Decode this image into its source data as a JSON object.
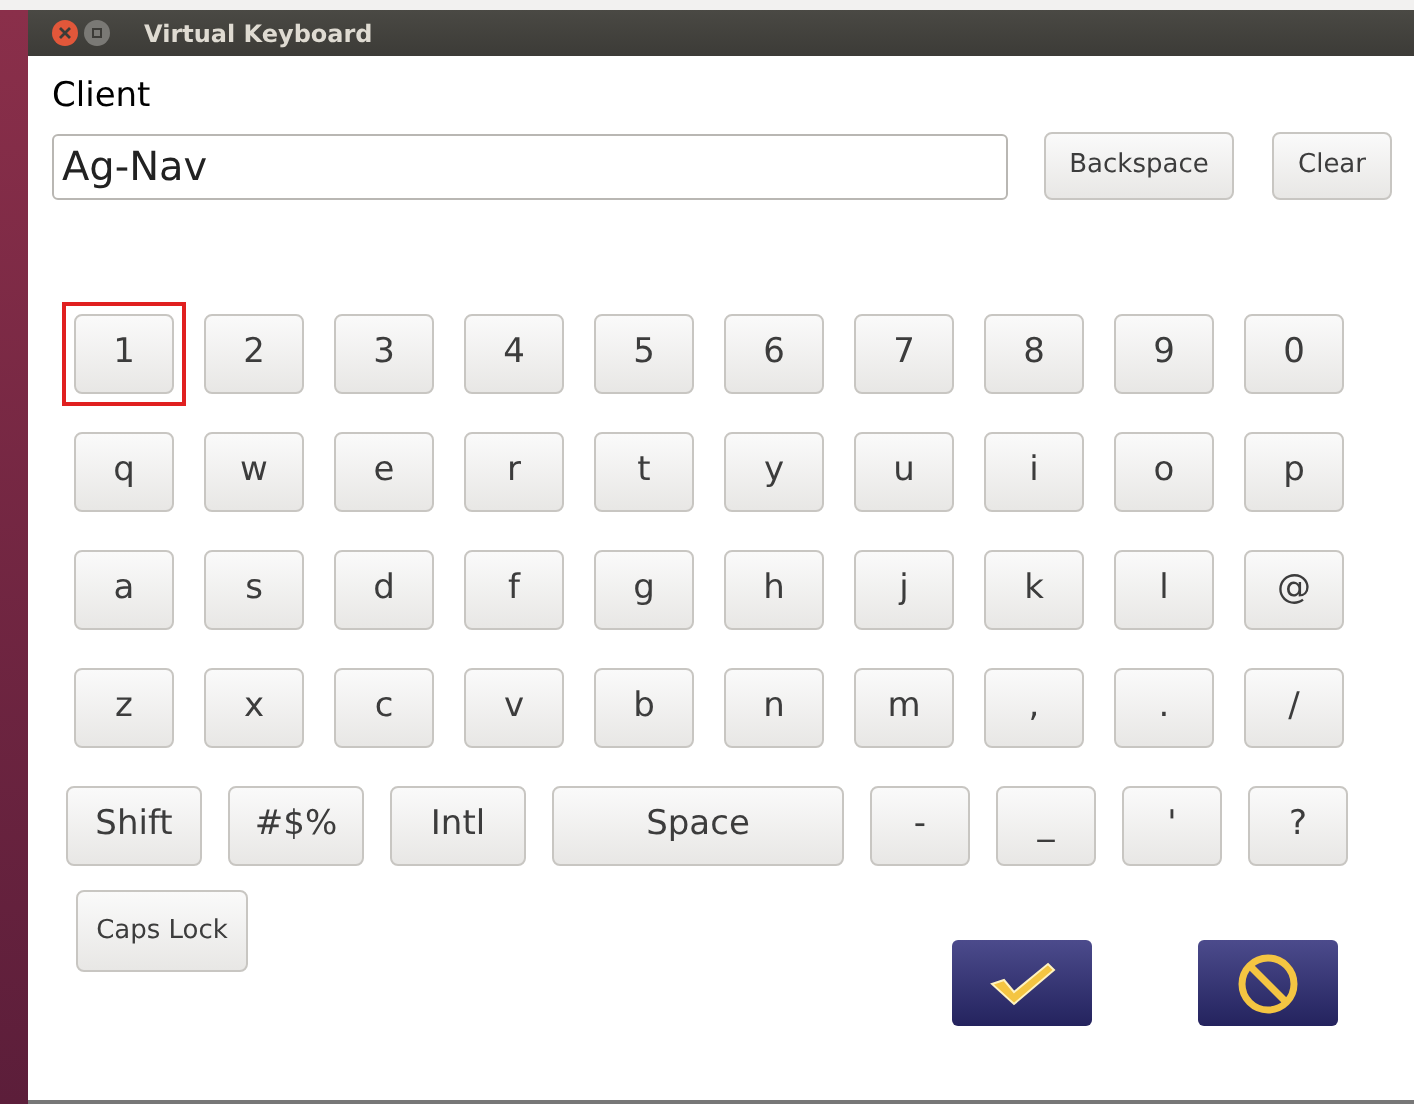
{
  "window": {
    "title": "Virtual Keyboard"
  },
  "field": {
    "label": "Client",
    "value": "Ag-Nav"
  },
  "edit_buttons": [
    "Backspace",
    "Clear"
  ],
  "rows": [
    {
      "keys": [
        {
          "label": "1",
          "kind": "key",
          "selected": true
        },
        {
          "label": "2",
          "kind": "key",
          "selected": false
        },
        {
          "label": "3",
          "kind": "key",
          "selected": false
        },
        {
          "label": "4",
          "kind": "key",
          "selected": false
        },
        {
          "label": "5",
          "kind": "key",
          "selected": false
        },
        {
          "label": "6",
          "kind": "key",
          "selected": false
        },
        {
          "label": "7",
          "kind": "key",
          "selected": false
        },
        {
          "label": "8",
          "kind": "key",
          "selected": false
        },
        {
          "label": "9",
          "kind": "key",
          "selected": false
        },
        {
          "label": "0",
          "kind": "key",
          "selected": false
        }
      ]
    },
    {
      "keys": [
        {
          "label": "q",
          "kind": "key",
          "selected": false
        },
        {
          "label": "w",
          "kind": "key",
          "selected": false
        },
        {
          "label": "e",
          "kind": "key",
          "selected": false
        },
        {
          "label": "r",
          "kind": "key",
          "selected": false
        },
        {
          "label": "t",
          "kind": "key",
          "selected": false
        },
        {
          "label": "y",
          "kind": "key",
          "selected": false
        },
        {
          "label": "u",
          "kind": "key",
          "selected": false
        },
        {
          "label": "i",
          "kind": "key",
          "selected": false
        },
        {
          "label": "o",
          "kind": "key",
          "selected": false
        },
        {
          "label": "p",
          "kind": "key",
          "selected": false
        }
      ]
    },
    {
      "keys": [
        {
          "label": "a",
          "kind": "key",
          "selected": false
        },
        {
          "label": "s",
          "kind": "key",
          "selected": false
        },
        {
          "label": "d",
          "kind": "key",
          "selected": false
        },
        {
          "label": "f",
          "kind": "key",
          "selected": false
        },
        {
          "label": "g",
          "kind": "key",
          "selected": false
        },
        {
          "label": "h",
          "kind": "key",
          "selected": false
        },
        {
          "label": "j",
          "kind": "key",
          "selected": false
        },
        {
          "label": "k",
          "kind": "key",
          "selected": false
        },
        {
          "label": "l",
          "kind": "key",
          "selected": false
        },
        {
          "label": "@",
          "kind": "key",
          "selected": false
        }
      ]
    },
    {
      "keys": [
        {
          "label": "z",
          "kind": "key",
          "selected": false
        },
        {
          "label": "x",
          "kind": "key",
          "selected": false
        },
        {
          "label": "c",
          "kind": "key",
          "selected": false
        },
        {
          "label": "v",
          "kind": "key",
          "selected": false
        },
        {
          "label": "b",
          "kind": "key",
          "selected": false
        },
        {
          "label": "n",
          "kind": "key",
          "selected": false
        },
        {
          "label": "m",
          "kind": "key",
          "selected": false
        },
        {
          "label": ",",
          "kind": "key",
          "selected": false
        },
        {
          "label": ".",
          "kind": "key",
          "selected": false
        },
        {
          "label": "/",
          "kind": "key",
          "selected": false
        }
      ]
    },
    {
      "keys": [
        {
          "label": "Shift",
          "kind": "mod",
          "selected": false
        },
        {
          "label": "#$%",
          "kind": "mod",
          "selected": false
        },
        {
          "label": "Intl",
          "kind": "mod",
          "selected": false
        },
        {
          "label": "Space",
          "kind": "space",
          "selected": false
        },
        {
          "label": "-",
          "kind": "key",
          "selected": false
        },
        {
          "label": "_",
          "kind": "key",
          "selected": false
        },
        {
          "label": "'",
          "kind": "key",
          "selected": false
        },
        {
          "label": "?",
          "kind": "key",
          "selected": false
        }
      ]
    }
  ],
  "caps_lock": {
    "label": "Caps Lock"
  }
}
